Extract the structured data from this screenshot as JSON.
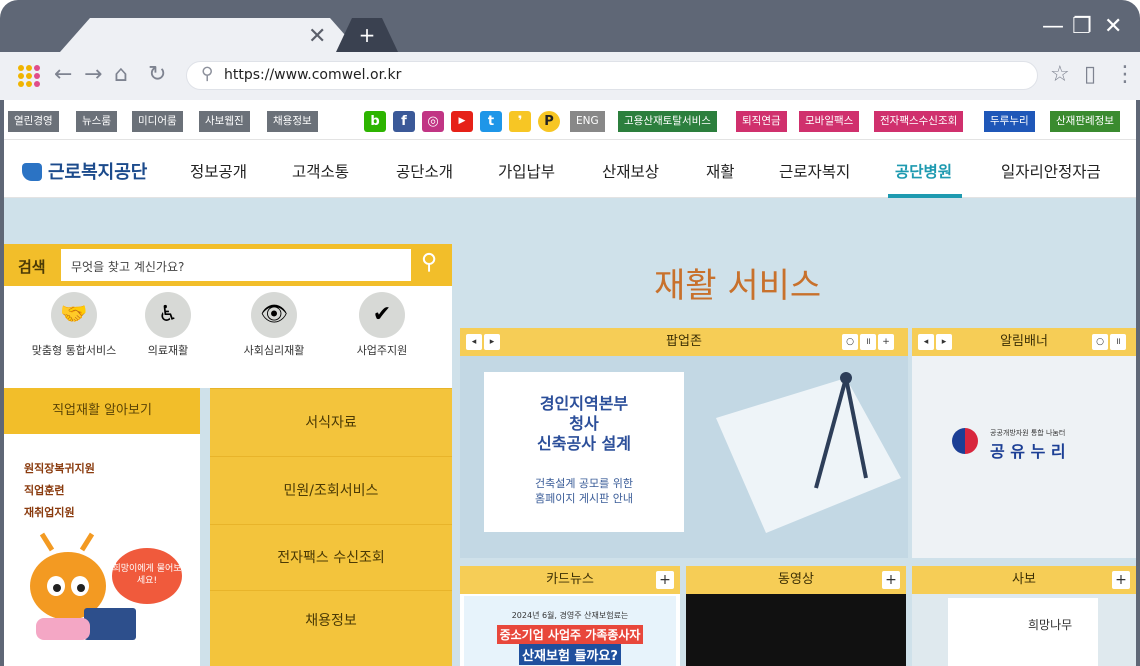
{
  "browser": {
    "url": "https://www.comwel.or.kr",
    "tab_close": "✕",
    "new_tab": "+",
    "win_min": "—",
    "win_max": "❐",
    "win_close": "✕"
  },
  "util": {
    "left": [
      "열린경영",
      "뉴스룸",
      "미디어룸",
      "사보웹진",
      "채용정보"
    ],
    "eng": "ENG",
    "right": [
      "고용산재토탈서비스",
      "퇴직연금",
      "모바일팩스",
      "전자팩스수신조회",
      "두루누리",
      "산재판례정보"
    ],
    "sns": [
      "b",
      "f",
      "◎",
      "▶",
      "t",
      "❜",
      "P"
    ]
  },
  "gnb": {
    "logo": "근로복지공단",
    "menu": [
      "정보공개",
      "고객소통",
      "공단소개",
      "가입납부",
      "산재보상",
      "재활",
      "근로자복지",
      "공단병원",
      "일자리안정자금"
    ]
  },
  "search": {
    "label": "검색",
    "placeholder": "무엇을 찾고 계신가요?"
  },
  "quick": [
    "맞춤형 통합서비스",
    "의료재활",
    "사회심리재활",
    "사업주지원"
  ],
  "job": {
    "title": "직업재활 알아보기",
    "links": [
      "원직장복귀지원",
      "직업훈련",
      "재취업지원"
    ],
    "bubble": "희망이에게 물어보세요!"
  },
  "tiles": [
    "서식자료",
    "민원/조회서비스",
    "전자팩스 수신조회",
    "채용정보"
  ],
  "banner": {
    "title": "재활 서비스"
  },
  "popup": {
    "title": "팝업존",
    "card_head": [
      "경인지역본부",
      "청사",
      "신축공사 설계"
    ],
    "card_sub": [
      "건축설계 공모를 위한",
      "홈페이지 게시판 안내"
    ]
  },
  "alert": {
    "title": "알림배너",
    "logo_small": "공공개방자원 통합 나눔터",
    "logo_big": "공 유 누 리"
  },
  "bottom": [
    "카드뉴스",
    "동영상",
    "사보"
  ],
  "card_news": {
    "line1": "2024년 6월, 경영주 산재보험료는",
    "line2": "중소기업 사업주 가족종사자",
    "line3": "산재보험 들까요?"
  },
  "sabo": {
    "title": "희망나무"
  }
}
